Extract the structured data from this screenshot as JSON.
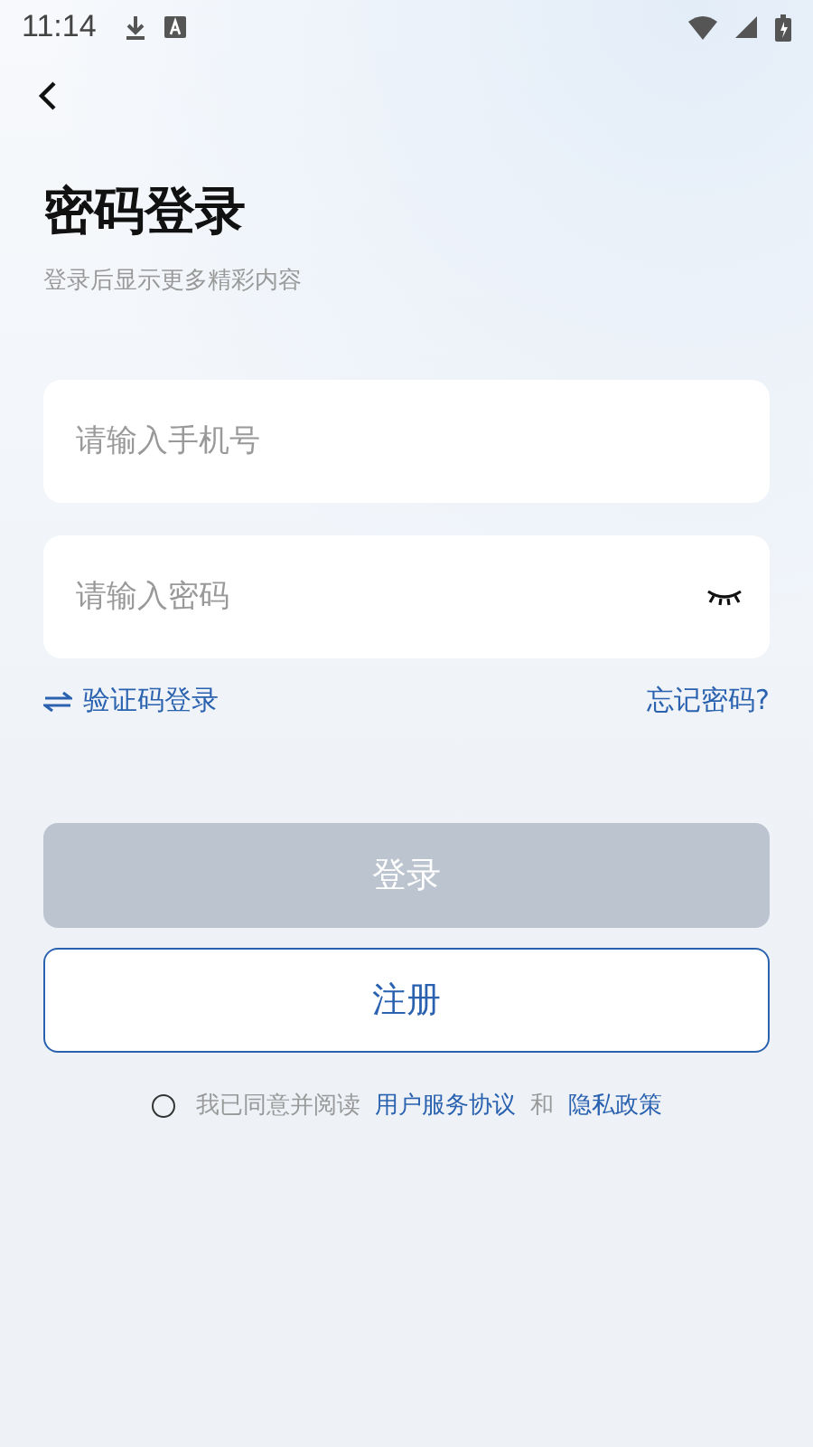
{
  "status_bar": {
    "time": "11:14"
  },
  "header": {
    "title": "密码登录",
    "subtitle": "登录后显示更多精彩内容"
  },
  "fields": [
    {
      "placeholder": "请输入手机号",
      "kind": "phone"
    },
    {
      "placeholder": "请输入密码",
      "kind": "password"
    }
  ],
  "links": {
    "switch": "验证码登录",
    "forgot": "忘记密码?"
  },
  "login_button": {
    "label": "登录",
    "disabled": true
  },
  "register_button": {
    "label": "注册"
  },
  "agreement": {
    "checked": false,
    "text": "我已同意并阅读",
    "terms": "用户服务协议",
    "and": "和",
    "privacy": "隐私政策"
  }
}
